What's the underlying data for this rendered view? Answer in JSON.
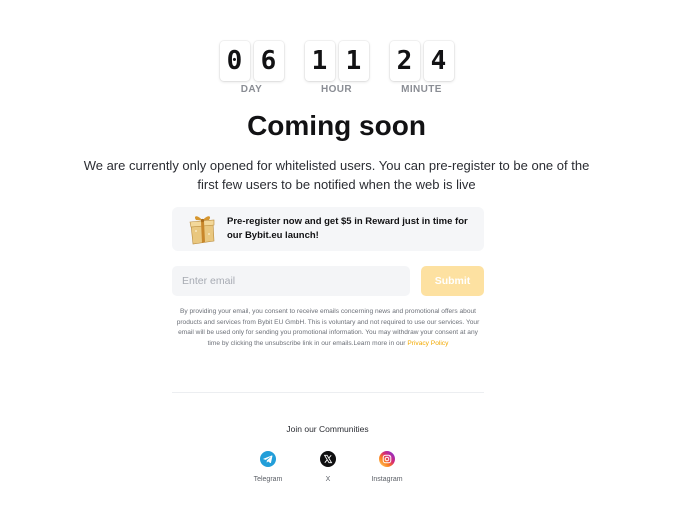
{
  "countdown": {
    "day": {
      "digits": [
        "0",
        "6"
      ],
      "label": "DAY"
    },
    "hour": {
      "digits": [
        "1",
        "1"
      ],
      "label": "HOUR"
    },
    "minute": {
      "digits": [
        "2",
        "4"
      ],
      "label": "MINUTE"
    }
  },
  "title": "Coming soon",
  "subtitle": "We are currently only opened for whitelisted users. You can pre-register to be one of the first few users to be notified when the web is live",
  "promo": {
    "icon": "gift-icon",
    "text": "Pre-register now and get $5 in Reward just in time for our Bybit.eu launch!"
  },
  "form": {
    "email_placeholder": "Enter email",
    "email_value": "",
    "submit_label": "Submit"
  },
  "disclaimer": {
    "text": "By providing your email, you consent to receive emails concerning news and promotional offers about products and services from Bybit EU GmbH. This is voluntary and not required to use our services. Your email will be used only for sending you promotional information. You may withdraw your consent at any time by clicking the unsubscribe link in our emails.Learn more in our ",
    "link_text": "Privacy Policy"
  },
  "community": {
    "title": "Join our Communities",
    "items": [
      {
        "label": "Telegram",
        "icon": "telegram-icon"
      },
      {
        "label": "X",
        "icon": "x-icon"
      },
      {
        "label": "Instagram",
        "icon": "instagram-icon"
      }
    ]
  },
  "colors": {
    "accent": "#f7a600",
    "submit_disabled": "#fde1a1",
    "link": "#f2a900",
    "telegram": "#229ed9"
  }
}
